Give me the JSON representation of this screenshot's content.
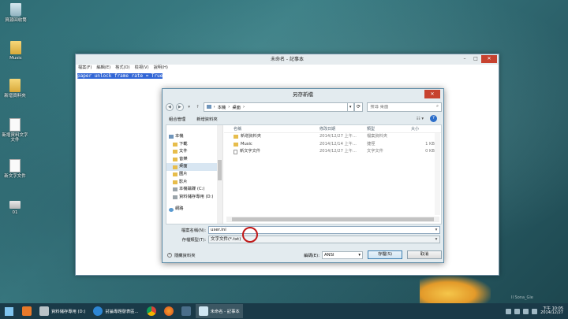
{
  "desktop": {
    "icons": [
      {
        "label": "資源回收筒"
      },
      {
        "label": "Music"
      },
      {
        "label": "新增資料夾"
      },
      {
        "label": "新增資料文字文件"
      },
      {
        "label": "新文字文件"
      },
      {
        "label": "01"
      }
    ]
  },
  "notepad": {
    "title": "未命名 - 記事本",
    "menus": [
      "檔案(F)",
      "編輯(E)",
      "格式(O)",
      "檢視(V)",
      "說明(H)"
    ],
    "text": "paper unlock frame rate = True"
  },
  "dialog": {
    "title": "另存新檔",
    "address": {
      "path": [
        "本機",
        "桌面"
      ]
    },
    "search_placeholder": "搜尋 桌面",
    "toolbar": {
      "organize": "組合管理",
      "new_folder": "新增資料夾"
    },
    "nav_items": [
      {
        "label": "本機",
        "icon": "computer-icon"
      },
      {
        "label": "下載",
        "icon": "folder-icon"
      },
      {
        "label": "文件",
        "icon": "folder-icon"
      },
      {
        "label": "音樂",
        "icon": "folder-icon"
      },
      {
        "label": "桌面",
        "icon": "folder-icon",
        "selected": true
      },
      {
        "label": "圖片",
        "icon": "folder-icon"
      },
      {
        "label": "影片",
        "icon": "folder-icon"
      },
      {
        "label": "本機磁碟 (C:)",
        "icon": "drive-icon"
      },
      {
        "label": "資料儲存專用 (D:)",
        "icon": "drive-icon"
      },
      {
        "label": "網路",
        "icon": "network-icon"
      }
    ],
    "columns": {
      "name": "名稱",
      "date": "修改日期",
      "type": "類型",
      "size": "大小"
    },
    "files": [
      {
        "name": "新增資料夾",
        "date": "2014/12/27 上午...",
        "type": "檔案資料夾",
        "size": "",
        "icon": "folder-icon"
      },
      {
        "name": "Music",
        "date": "2014/12/14 上午...",
        "type": "捷徑",
        "size": "1 KB",
        "icon": "folder-icon"
      },
      {
        "name": "新文字文件",
        "date": "2014/12/27 上午...",
        "type": "文字文件",
        "size": "0 KB",
        "icon": "document-icon"
      }
    ],
    "filename_label": "檔案名稱(N):",
    "filename_value": "user.ini",
    "filetype_label": "存檔類型(T):",
    "filetype_value": "文字文件(*.txt)",
    "hide_folders": "隱藏資料夾",
    "encoding_label": "編碼(E):",
    "encoding_value": "ANSI",
    "save": "存檔(S)",
    "cancel": "取消"
  },
  "taskbar": {
    "apps": [
      {
        "label": "資料儲存專用 (D:)"
      },
      {
        "label": "討論專題發表區..."
      },
      {
        "label": "未命名 - 記事本"
      }
    ],
    "clock_time": "下午 10:05",
    "clock_date": "2014/12/27"
  }
}
